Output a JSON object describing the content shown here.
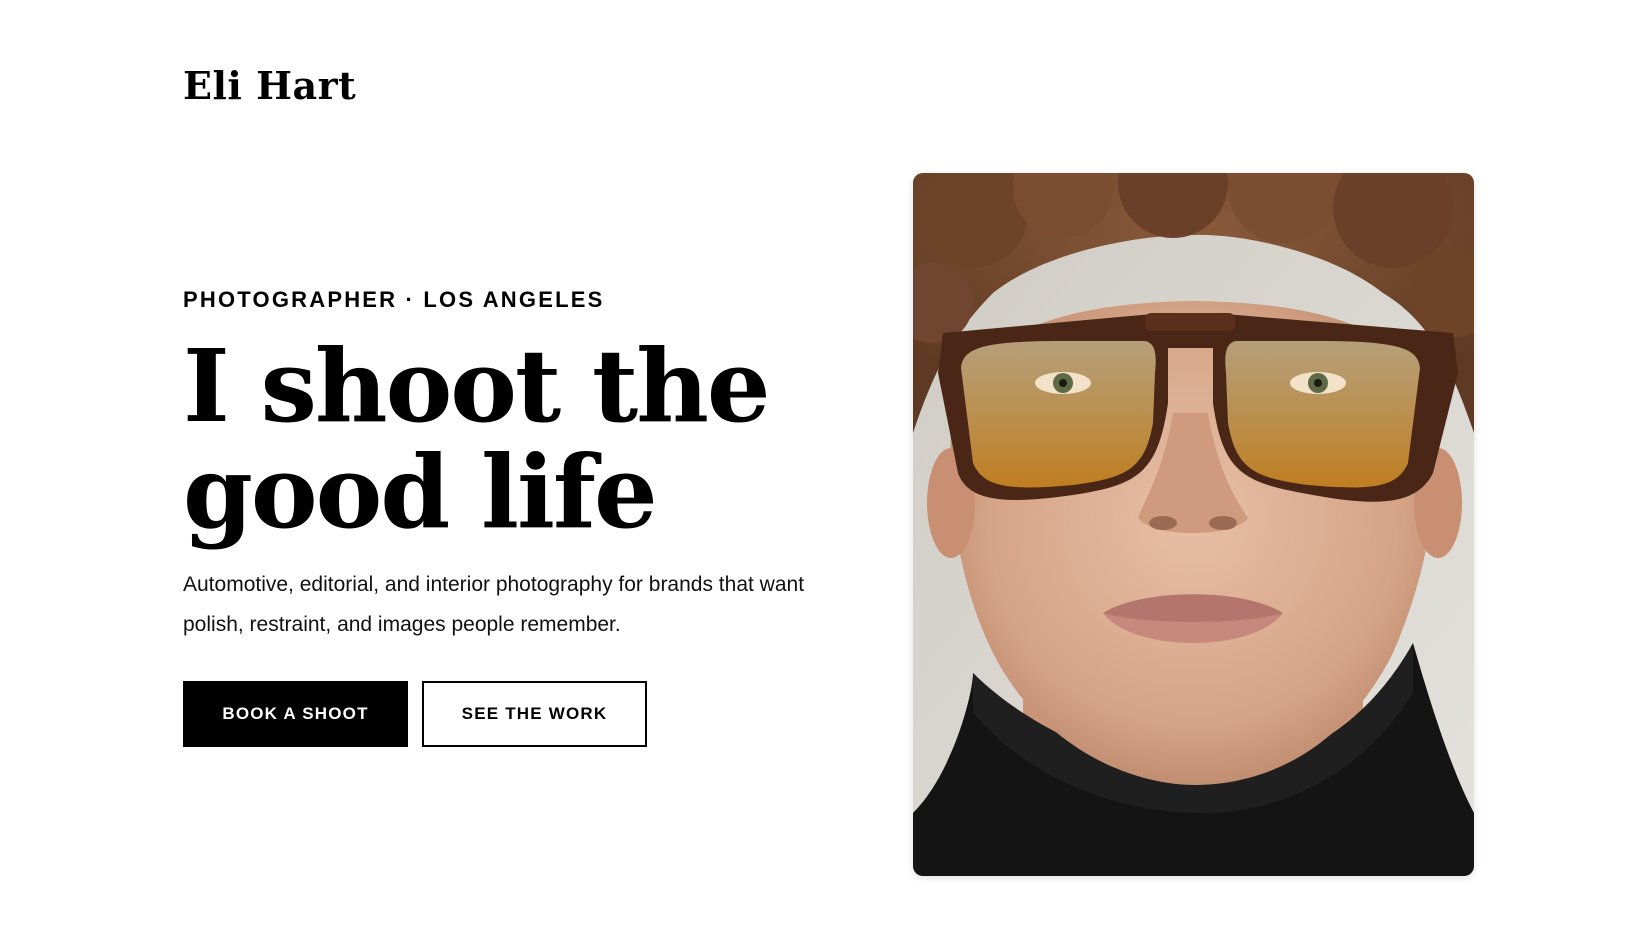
{
  "brand": {
    "name": "Eli Hart"
  },
  "hero": {
    "eyebrow": "PHOTOGRAPHER · LOS ANGELES",
    "headline_line1": "I shoot the",
    "headline_line2": "good life",
    "subcopy": "Automotive, editorial, and interior photography for brands that want polish, restraint, and images people remember.",
    "primary_cta": "BOOK A SHOOT",
    "secondary_cta": "SEE THE WORK"
  },
  "image": {
    "subject": "portrait of a man with curly auburn hair, amber tinted tortoiseshell aviator glasses, black turtleneck"
  },
  "colors": {
    "background": "#ffffff",
    "text": "#000000",
    "primary_button_bg": "#000000",
    "primary_button_text": "#ffffff"
  }
}
